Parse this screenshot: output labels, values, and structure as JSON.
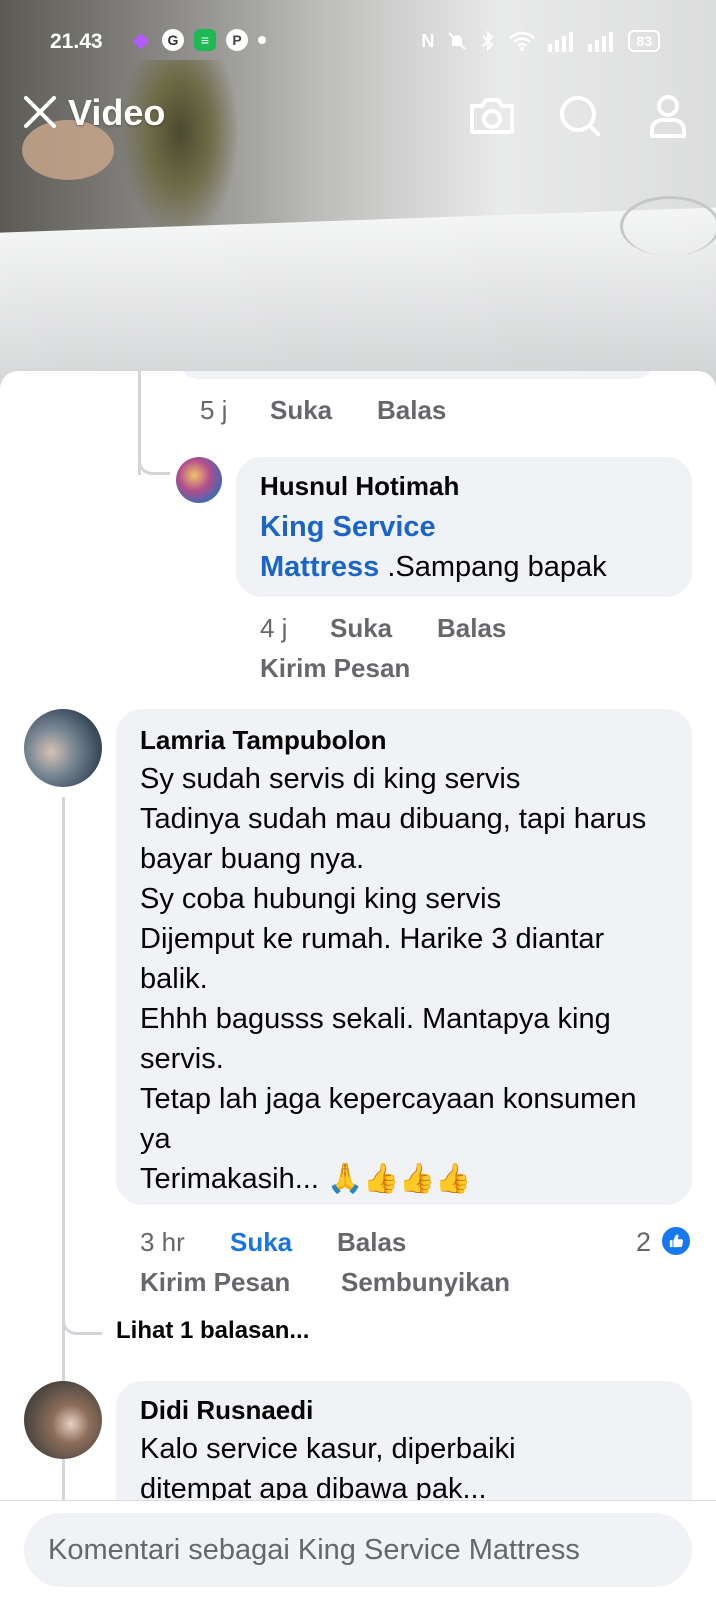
{
  "status_bar": {
    "time": "21.43",
    "battery": "83",
    "icons": [
      "twitch-icon",
      "g-app-icon",
      "spotify-icon",
      "pinterest-icon",
      "notification-dot",
      "nfc-icon",
      "mute-icon",
      "bluetooth-icon",
      "wifi-icon",
      "signal-icon",
      "signal-icon"
    ]
  },
  "header": {
    "title": "Video",
    "icons": [
      "close-icon",
      "camera-icon",
      "search-icon",
      "profile-icon"
    ]
  },
  "comments": [
    {
      "id": "partial",
      "time": "5 j",
      "like_label": "Suka",
      "reply_label": "Balas"
    },
    {
      "id": "husnul",
      "author": "Husnul Hotimah",
      "mention_line1": "King Service",
      "mention_line2": "Mattress",
      "text": " .Sampang  bapak",
      "time": "4 j",
      "like_label": "Suka",
      "reply_label": "Balas",
      "message_label": "Kirim Pesan"
    },
    {
      "id": "lamria",
      "author": "Lamria Tampubolon",
      "text": "Sy sudah servis di king servis\nTadinya sudah mau dibuang, tapi harus bayar buang nya.\nSy coba hubungi king servis\nDijemput ke rumah. Harike 3 diantar balik.\nEhhh bagusss sekali. Mantapya king servis.\nTetap lah jaga kepercayaan konsumen ya\nTerimakasih... 🙏👍👍👍",
      "time": "3 hr",
      "like_label": "Suka",
      "reply_label": "Balas",
      "message_label": "Kirim Pesan",
      "hide_label": "Sembunyikan",
      "reaction_count": "2",
      "view_replies": "Lihat 1 balasan..."
    },
    {
      "id": "didi",
      "author": "Didi Rusnaedi",
      "text": "Kalo service kasur, diperbaiki ditempat apa dibawa pak..."
    }
  ],
  "input": {
    "placeholder": "Komentari sebagai King Service Mattress"
  },
  "colors": {
    "link": "#1b65c9",
    "like_active": "#1b74e4",
    "bubble": "#f0f2f5",
    "meta": "#65676b"
  }
}
